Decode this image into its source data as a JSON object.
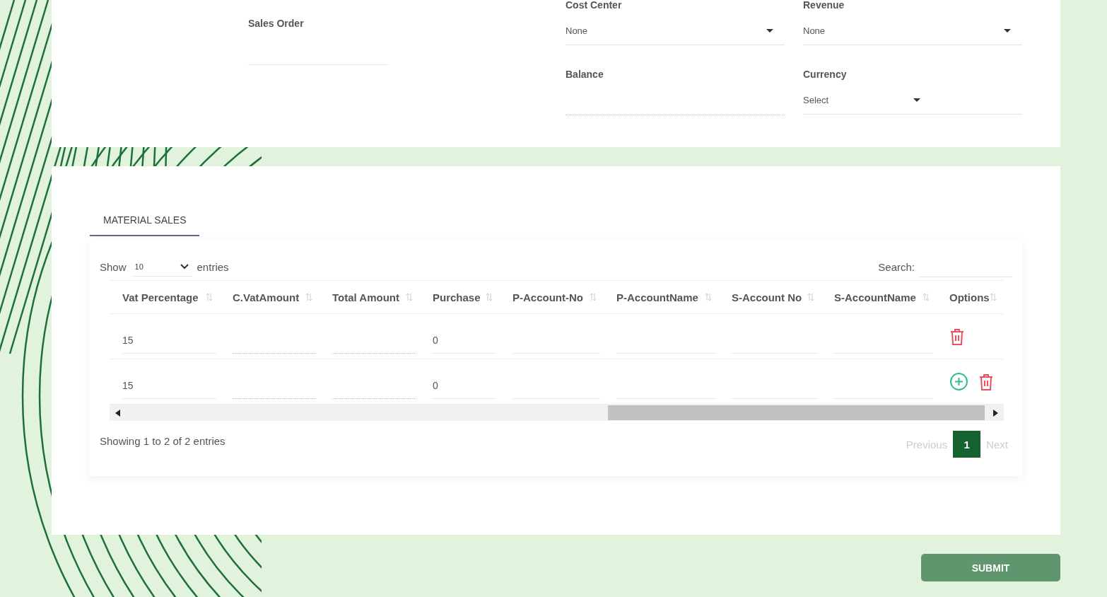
{
  "header_form": {
    "sales_order": {
      "label": "Sales Order"
    },
    "cost_center": {
      "label": "Cost Center",
      "value": "None"
    },
    "revenue": {
      "label": "Revenue",
      "value": "None"
    },
    "balance": {
      "label": "Balance"
    },
    "currency": {
      "label": "Currency",
      "value": "Select"
    }
  },
  "tabs": [
    {
      "label": "MATERIAL SALES",
      "selected": true
    }
  ],
  "table_controls": {
    "show_label": "Show",
    "page_size": "10",
    "entries_label": "entries",
    "search_label": "Search:"
  },
  "table": {
    "columns": [
      "Vat Percentage",
      "C.VatAmount",
      "Total Amount",
      "Purchase",
      "P-Account-No",
      "P-AccountName",
      "S-Account No",
      "S-AccountName",
      "Options"
    ],
    "rows": [
      {
        "cells": [
          {
            "value": "15",
            "readonly": false
          },
          {
            "readonly": true
          },
          {
            "readonly": true
          },
          {
            "value": "0",
            "readonly": false
          },
          {
            "readonly": false
          },
          {
            "readonly": false
          },
          {
            "readonly": false
          },
          {
            "readonly": false
          }
        ],
        "options": [
          {
            "kind": "delete"
          }
        ]
      },
      {
        "cells": [
          {
            "value": "15",
            "readonly": false
          },
          {
            "readonly": true
          },
          {
            "readonly": true
          },
          {
            "value": "0",
            "readonly": false
          },
          {
            "readonly": false
          },
          {
            "readonly": false
          },
          {
            "readonly": false
          },
          {
            "readonly": false
          }
        ],
        "options": [
          {
            "kind": "add"
          },
          {
            "kind": "delete"
          }
        ]
      }
    ]
  },
  "footer": {
    "info": "Showing 1 to 2 of 2 entries",
    "previous": "Previous",
    "pages": [
      {
        "label": "1",
        "selected": true
      }
    ],
    "next": "Next"
  },
  "submit": "SUBMIT"
}
